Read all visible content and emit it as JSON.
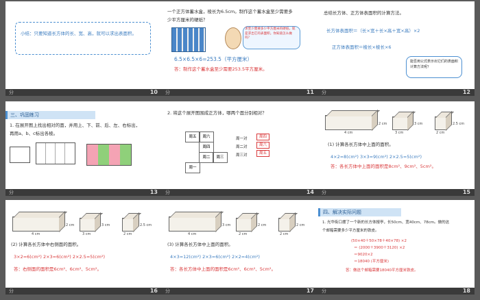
{
  "slides": [
    {
      "num": "10",
      "lbl": "分",
      "text": "小结：只要知道长方体的长、宽、高，就可以求出表面积。"
    },
    {
      "num": "11",
      "lbl": "分",
      "q1": "一个正方体蓄水盒，棱长为6.5cm。制作这个蓄水盒至少需要多",
      "q2": "少平方厘米的硬纸？",
      "bubble": "求至少需要多少平方厘米的硬纸，就是求出它的表面积。你知道怎么做吗？",
      "calc": "6.5×6.5×6=253.5（平方厘米）",
      "ans": "答：制作这个蓄水盒至少需要253.5平方厘米。"
    },
    {
      "num": "12",
      "lbl": "分",
      "h": "总结长方体、正方体表面积的计算方法。",
      "f1": "长方体表面积＝（长×宽＋长×高＋宽×高）×2",
      "f2": "正方体表面积＝棱长×棱长×6",
      "bubble": "能否用公式表示出它们的表面积计算方法呢？"
    },
    {
      "num": "13",
      "lbl": "分",
      "tag": "三、巩固练习",
      "q1": "1. 在展开图上找出相对的面，并用上、下、前、后、左、右标出，",
      "q2": "再用a、b、c标出各棱。"
    },
    {
      "num": "14",
      "lbl": "分",
      "q": "2. 将这个展开图围成正方体，哪两个面分别相对？",
      "rows": [
        {
          "k": "周一对",
          "v": "周四"
        },
        {
          "k": "周二对",
          "v": "周六"
        },
        {
          "k": "周三对",
          "v": "周五"
        }
      ],
      "faces": [
        "周五",
        "周六",
        "周四",
        "周二",
        "周三",
        "周一"
      ]
    },
    {
      "num": "15",
      "lbl": "分",
      "q": "(1) 计算各长方体中上面的面积。",
      "calc": "4×2=8(cm²)      3×3=9(cm²)      2×2.5=5(cm²)",
      "ans": "答：各长方体中上面的面积是8cm²、9cm²、5cm²。",
      "dims": [
        "4 cm",
        "2 cm",
        "3 cm",
        "3 cm",
        "2.5 cm",
        "2 cm"
      ]
    },
    {
      "num": "16",
      "lbl": "分",
      "q": "(2) 计算各长方体中右侧面的面积。",
      "calc": "3×2=6(cm²)      2×3=6(cm²)      2×2.5=5(cm²)",
      "ans": "答：右侧面的面积是6cm²、6cm²、5cm²。",
      "dims": [
        "4 cm",
        "2 cm",
        "3 cm",
        "3 cm",
        "2 cm",
        "2.5 cm"
      ]
    },
    {
      "num": "17",
      "lbl": "分",
      "q": "(3) 计算各长方体中上面的面积。",
      "calc": "4×3=12(cm²)      2×3=6(cm²)      2×2=4(cm²)",
      "ans": "答：各长方体中上面的面积是6cm²、6cm²、5cm²。",
      "dims": [
        "4 cm",
        "3 cm",
        "2 cm",
        "2 cm",
        "2 cm",
        "2 cm"
      ]
    },
    {
      "num": "18",
      "lbl": "分",
      "tag": "四、解决实际问题",
      "q1": "1. 光华街口摆了一个新的长方体报亭，长50cm、宽40cm、78cm。做的这",
      "q2": "个邮箱需要多少平方厘米的铁皮。",
      "c1": "(50×40＋50×78＋40×78) ×2",
      "c2": "＝ (2000＋3900＋3120) ×2",
      "c3": "＝9020×2",
      "c4": "＝18040 (平方厘米)",
      "ans": "答：做这个邮箱需要18040平方厘米铁皮。"
    }
  ]
}
